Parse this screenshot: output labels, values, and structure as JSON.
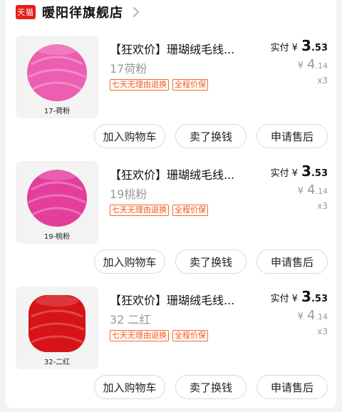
{
  "shop": {
    "badge": "天猫",
    "name": "暖阳徉旗舰店"
  },
  "items": [
    {
      "title": "【狂欢价】珊瑚绒毛线...",
      "variant": "17荷粉",
      "thumb_caption": "17-荷粉",
      "yarn_color": "#ec5fb0",
      "tags": [
        "七天无理由退换",
        "全程价保"
      ],
      "paid_label": "实付",
      "currency": "¥",
      "paid_int": "3",
      "paid_dec": ".53",
      "orig_int": "4",
      "orig_dec": ".14",
      "qty": "x3",
      "buttons": [
        "加入购物车",
        "卖了换钱",
        "申请售后"
      ]
    },
    {
      "title": "【狂欢价】珊瑚绒毛线...",
      "variant": "19桃粉",
      "thumb_caption": "19-桃粉",
      "yarn_color": "#e33e9c",
      "tags": [
        "七天无理由退换",
        "全程价保"
      ],
      "paid_label": "实付",
      "currency": "¥",
      "paid_int": "3",
      "paid_dec": ".53",
      "orig_int": "4",
      "orig_dec": ".14",
      "qty": "x3",
      "buttons": [
        "加入购物车",
        "卖了换钱",
        "申请售后"
      ]
    },
    {
      "title": "【狂欢价】珊瑚绒毛线...",
      "variant": "32 二红",
      "thumb_caption": "32-二红",
      "yarn_color": "#d61418",
      "tags": [
        "七天无理由退换",
        "全程价保"
      ],
      "paid_label": "实付",
      "currency": "¥",
      "paid_int": "3",
      "paid_dec": ".53",
      "orig_int": "4",
      "orig_dec": ".14",
      "qty": "x3",
      "buttons": [
        "加入购物车",
        "卖了换钱",
        "申请售后"
      ]
    }
  ]
}
